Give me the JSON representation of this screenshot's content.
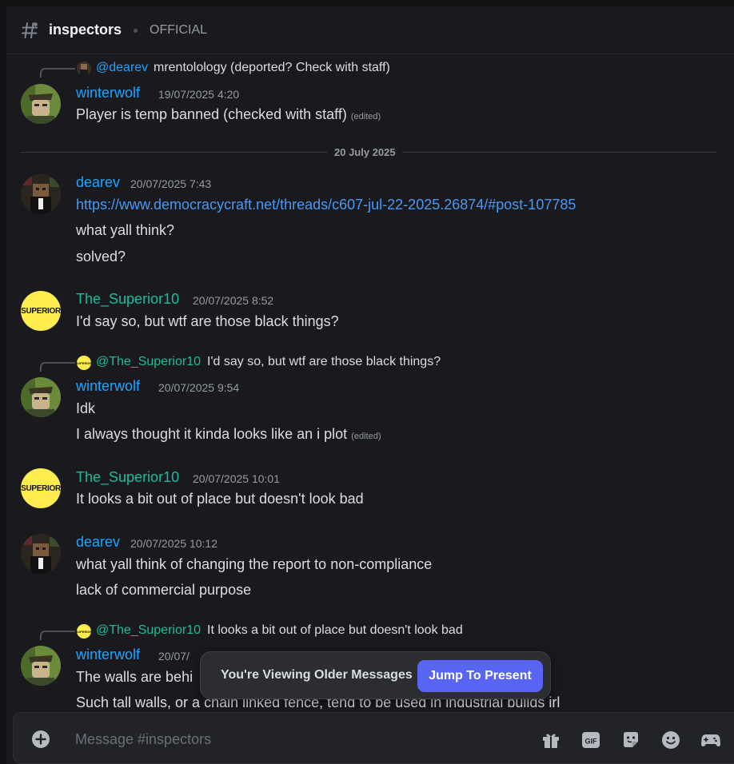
{
  "channel": {
    "name": "inspectors",
    "topic": "OFFICIAL"
  },
  "messages": {
    "m1": {
      "reply": {
        "name": "@dearev",
        "text": "mrentolology (deported? Check with staff)"
      },
      "author": "winterwolf",
      "timestamp": "19/07/2025 4:20",
      "lines": [
        "Player is temp banned (checked with staff)"
      ],
      "edited": "(edited)"
    },
    "divider": "20 July 2025",
    "m2": {
      "author": "dearev",
      "timestamp": "20/07/2025 7:43",
      "link": "https://www.democracycraft.net/threads/c607-jul-22-2025.26874/#post-107785",
      "lines": [
        "what yall think?",
        "solved?"
      ]
    },
    "m3": {
      "author": "The_Superior10",
      "timestamp": "20/07/2025 8:52",
      "lines": [
        "I'd say so, but wtf are those black things?"
      ]
    },
    "m4": {
      "reply": {
        "name": "@The_Superior10",
        "text": "I'd say so, but wtf are those black things?"
      },
      "author": "winterwolf",
      "timestamp": "20/07/2025 9:54",
      "lines": [
        "Idk",
        "I always thought it kinda looks like an i plot"
      ],
      "edited": "(edited)"
    },
    "m5": {
      "author": "The_Superior10",
      "timestamp": "20/07/2025 10:01",
      "lines": [
        "It looks a bit out of place but doesn't look bad"
      ]
    },
    "m6": {
      "author": "dearev",
      "timestamp": "20/07/2025 10:12",
      "lines": [
        "what yall think of changing the report to non-compliance",
        "lack of commercial purpose"
      ]
    },
    "m7": {
      "reply": {
        "name": "@The_Superior10",
        "text": "It looks a bit out of place but doesn't look bad"
      },
      "author": "winterwolf",
      "timestamp": "20/07/",
      "lines": [
        "The walls are behi",
        "Such tall walls, or a chain linked fence, tend to be used in industrial builds irl"
      ]
    }
  },
  "avatars": {
    "superior_text": "SUPERIOR"
  },
  "older_bar": {
    "text": "You're Viewing Older Messages",
    "button": "Jump To Present"
  },
  "composer": {
    "placeholder": "Message #inspectors",
    "gif_label": "GIF"
  },
  "icons": [
    "hash-icon",
    "plus-icon",
    "gift-icon",
    "gif-icon",
    "sticker-icon",
    "emoji-icon",
    "activities-icon"
  ],
  "colors": {
    "background": "#1a1a1e",
    "name_blue": "#1ea3ff",
    "name_teal": "#1abc9c",
    "link": "#4a98f0",
    "accent": "#5865f2"
  }
}
